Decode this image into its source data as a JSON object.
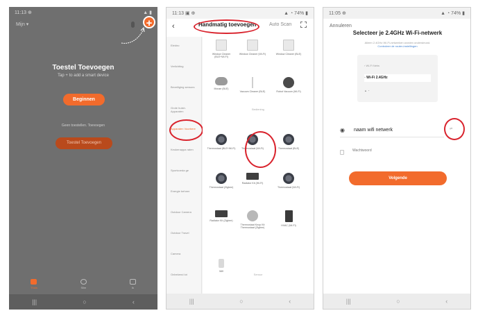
{
  "phone1": {
    "status_time": "11:13 ⊕",
    "status_icons": "▲ ▮",
    "home_label": "Mijn ▾",
    "title": "Toestel Toevoegen",
    "subtitle": "Tap + to add a smart device",
    "begin_button": "Beginnen",
    "hint": "Geen toestellen. Toevoegen",
    "add_device_button": "Toestel Toevoegen",
    "add_icon_glyph": "+",
    "tabs": [
      {
        "label": "Thuis",
        "icon": "home-icon"
      },
      {
        "label": "Slim",
        "icon": "scene-icon"
      },
      {
        "label": "Ik",
        "icon": "profile-icon"
      }
    ],
    "nav": [
      "|||",
      "○",
      "‹"
    ]
  },
  "phone2": {
    "status_time": "11:13 ▣ ⊕",
    "status_icons": "▲ ◔ 74% ▮",
    "back_glyph": "‹",
    "tab_manual": "Handmatig toevoegen",
    "tab_auto": "Auto Scan",
    "sidebar": [
      "Elektro",
      "Verlichting",
      "Beveiliging sensors",
      "Grote huish. Apparaten",
      "Apparaten Voorbere",
      "Keukenappa raten",
      "Sportvoeda ge",
      "Energie beheer",
      "Outdoor Camera",
      "Outdoor Travel",
      "Camera",
      "Onbekend lot",
      "Overig"
    ],
    "devices": [
      {
        "name": "Window Cleaner (BLE+Wi-Fi)",
        "icon": "window-cleaner-icon"
      },
      {
        "name": "Window Cleaner (Wi-Fi)",
        "icon": "window-cleaner-icon"
      },
      {
        "name": "Window Cleaner (BLE)",
        "icon": "window-cleaner-icon"
      },
      {
        "name": "Mouse (BLE)",
        "icon": "mouse-icon"
      },
      {
        "name": "Vacuum Cleaner (BLE)",
        "icon": "vacuum-icon"
      },
      {
        "name": "Robot Vacuum (Wi-Fi)",
        "icon": "robot-vacuum-icon"
      },
      {
        "name": "Thermostaat (BLE+Wi-Fi)",
        "icon": "thermostat-icon"
      },
      {
        "name": "Thermostaat (Wi-Fi)",
        "icon": "thermostat-icon"
      },
      {
        "name": "Thermostaat (BLE)",
        "icon": "thermostat-icon"
      },
      {
        "name": "Thermostaat (Zigbee)",
        "icon": "thermostat-icon"
      },
      {
        "name": "Radiator Kit (Wi-Fi)",
        "icon": "radiator-icon"
      },
      {
        "name": "Thermostaat (Wi-Fi)",
        "icon": "thermostat-icon"
      },
      {
        "name": "Radiator Kit (Zigbee)",
        "icon": "radiator-icon"
      },
      {
        "name": "Thermostaat Knop Kit Thermostaat (Zigbee)",
        "icon": "thermostat-knob-icon"
      },
      {
        "name": "HVAC (Wi-Fi)",
        "icon": "hvac-icon"
      },
      {
        "name": "Wifi",
        "icon": "plug-icon"
      }
    ],
    "section_labels": [
      "Bediening",
      "Sensor"
    ],
    "nav": [
      "|||",
      "○",
      "‹"
    ]
  },
  "phone3": {
    "status_time": "11:05 ⊕",
    "status_icons": "▲ ◔ 74% ▮",
    "cancel": "Annuleren",
    "title": "Selecteer je 2.4GHz Wi-Fi-netwerk",
    "desc": "Alleen 2.4GHz Wi-Fi-netwerken worden ondersteund.",
    "desc_link": "Controleer de router-instellingen",
    "mock_rows": [
      "‹ Wi-Fi Netw",
      "◦ Wi-Fi 2.4GHz",
      "▲ ◔"
    ],
    "ssid_glyph": "◉",
    "ssid_value": "naam wifi netwerk",
    "switch_label": "⇄",
    "password_placeholder": "Wachtwoord",
    "next_button": "Volgende",
    "nav": [
      "|||",
      "○",
      "‹"
    ]
  },
  "colors": {
    "accent": "#f26b2c",
    "annotation": "#d9232d"
  }
}
